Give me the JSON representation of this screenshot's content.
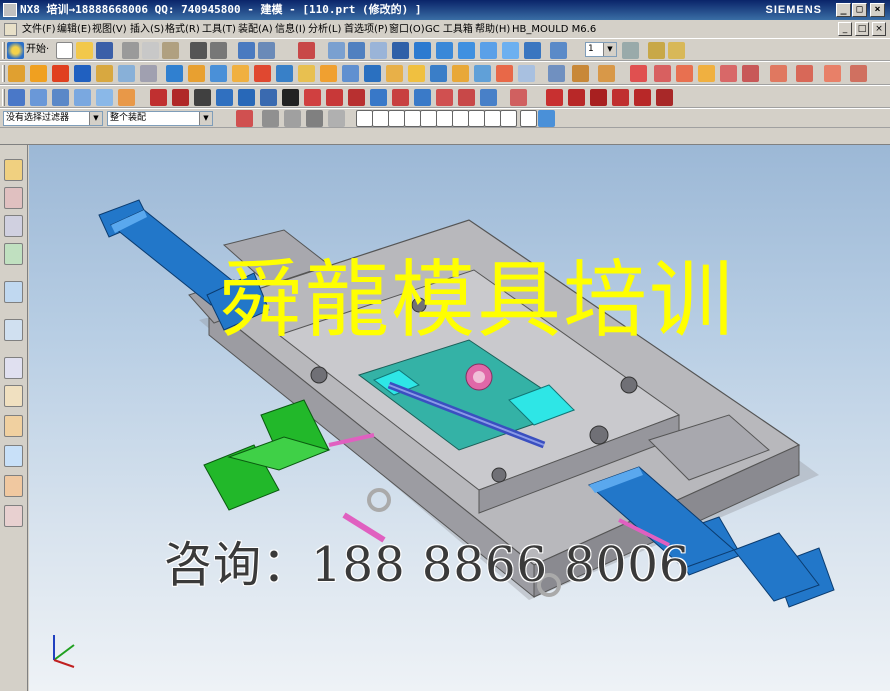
{
  "window": {
    "title": "NX8 培训→18888668006 QQ: 740945800 - 建模 - [110.prt (修改的) ]",
    "brand": "SIEMENS",
    "min": "_",
    "max": "□",
    "close": "×"
  },
  "menubar": {
    "items": [
      "文件(F)",
      "编辑(E)",
      "视图(V)",
      "插入(S)",
      "格式(R)",
      "工具(T)",
      "装配(A)",
      "信息(I)",
      "分析(L)",
      "首选项(P)",
      "窗口(O)",
      "GC 工具箱",
      "帮助(H)",
      "HB_MOULD M6.6"
    ]
  },
  "toolbar": {
    "start_label": "开始·",
    "layer_value": "1",
    "selection_filter": "没有选择过滤器",
    "assembly_scope": "整个装配"
  },
  "viewport": {
    "watermark_title": "舜龍模具培训",
    "watermark_phone": "咨询：188 8866 8006"
  },
  "colors": {
    "cylinder_blue": "#2277c9",
    "cylinder_green": "#22b82a",
    "mold_gray": "#b8b8bc",
    "cavity_teal": "#34b2a6",
    "watermark_yellow": "#ffff00"
  }
}
